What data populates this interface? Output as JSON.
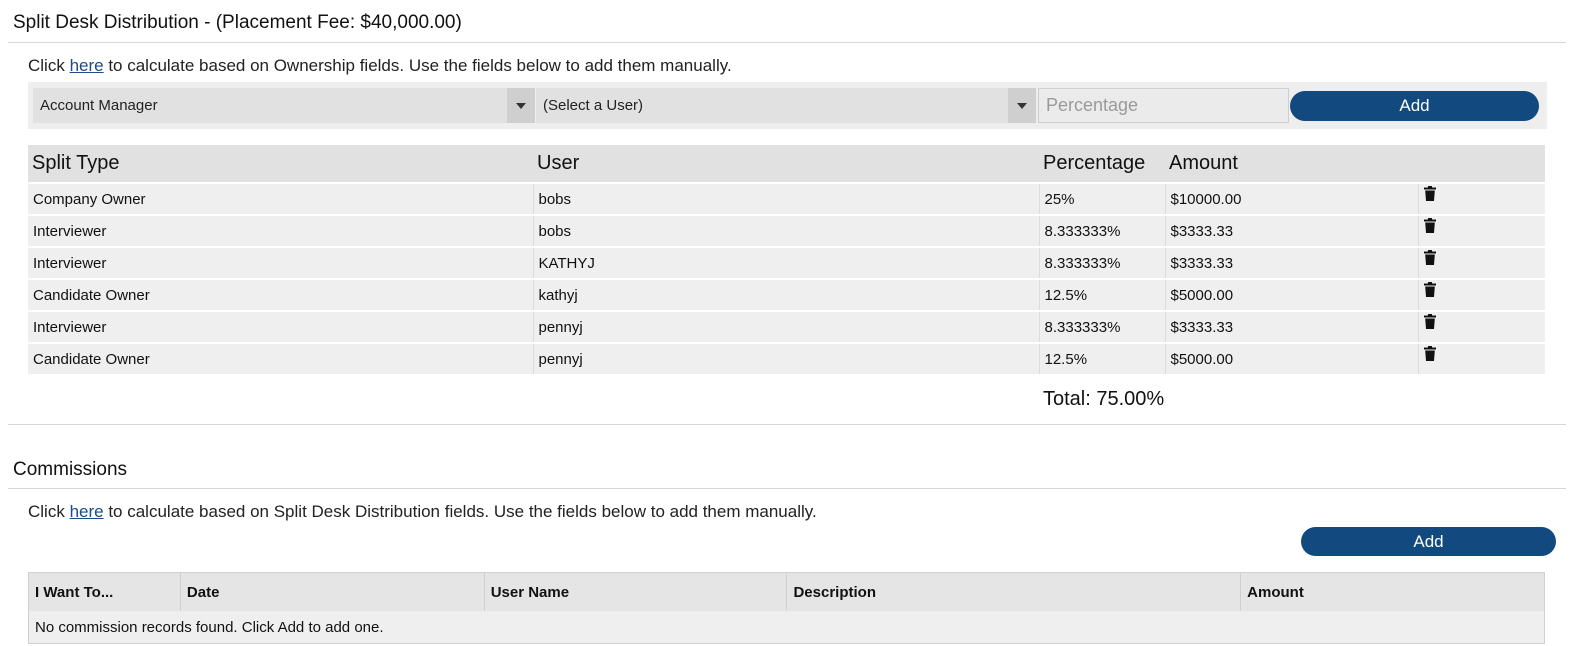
{
  "split": {
    "title": "Split Desk Distribution - (Placement Fee: $40,000.00)",
    "instruction_before": "Click ",
    "link": "here",
    "instruction_after": " to calculate based on Ownership fields. Use the fields below to add them manually.",
    "type_select": "Account Manager",
    "user_select": "(Select a User)",
    "percentage_placeholder": "Percentage",
    "add_label": "Add",
    "columns": [
      "Split Type",
      "User",
      "Percentage",
      "Amount"
    ],
    "rows": [
      {
        "type": "Company Owner",
        "user": "bobs",
        "percentage": "25%",
        "amount": "$10000.00"
      },
      {
        "type": "Interviewer",
        "user": "bobs",
        "percentage": "8.333333%",
        "amount": "$3333.33"
      },
      {
        "type": "Interviewer",
        "user": "KATHYJ",
        "percentage": "8.333333%",
        "amount": "$3333.33"
      },
      {
        "type": "Candidate Owner",
        "user": "kathyj",
        "percentage": "12.5%",
        "amount": "$5000.00"
      },
      {
        "type": "Interviewer",
        "user": "pennyj",
        "percentage": "8.333333%",
        "amount": "$3333.33"
      },
      {
        "type": "Candidate Owner",
        "user": "pennyj",
        "percentage": "12.5%",
        "amount": "$5000.00"
      }
    ],
    "total": "Total: 75.00%"
  },
  "commissions": {
    "title": "Commissions",
    "instruction_before": "Click ",
    "link": "here",
    "instruction_after": " to calculate based on Split Desk Distribution fields. Use the fields below to add them manually.",
    "add_label": "Add",
    "columns": [
      "I Want To...",
      "Date",
      "User Name",
      "Description",
      "Amount"
    ],
    "empty_message": "No commission records found. Click Add to add one."
  },
  "icons": {
    "delete": "trash-icon",
    "dropdown": "chevron-down-icon"
  },
  "colors": {
    "primary": "#124a80",
    "link": "#1b4b8a"
  }
}
